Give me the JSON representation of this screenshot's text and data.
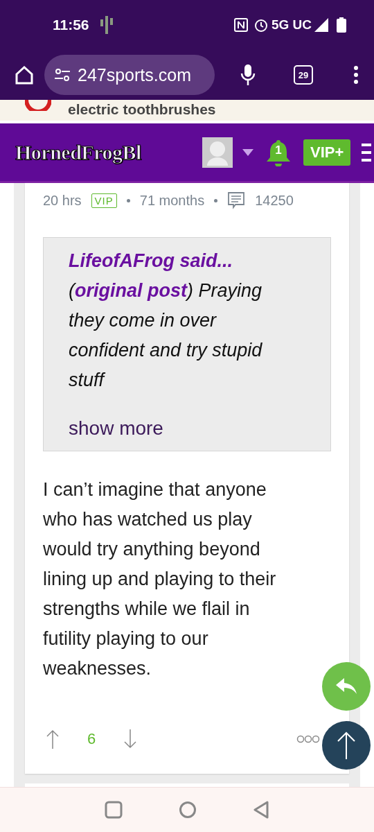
{
  "status_bar": {
    "time": "11:56",
    "network": "5G UC"
  },
  "browser": {
    "url": "247sports.com",
    "tab_count": "29"
  },
  "ad": {
    "text": "electric toothbrushes"
  },
  "site_header": {
    "logo": "HornedFrogBl",
    "notifications": "1",
    "vip_button": "VIP+"
  },
  "post": {
    "age": "20 hrs",
    "badge": "VIP",
    "tenure": "71 months",
    "post_count": "14250",
    "quote": {
      "author": "LifeofAFrog said...",
      "text": "(**original post**) Praying they come in over confident and try stupid stuff",
      "show_more": "show more"
    },
    "body": "I can’t imagine that anyone who has watched us play would try anything beyond lining up and playing to their strengths while we flail in futility playing to our weaknesses.",
    "votes": "6"
  }
}
